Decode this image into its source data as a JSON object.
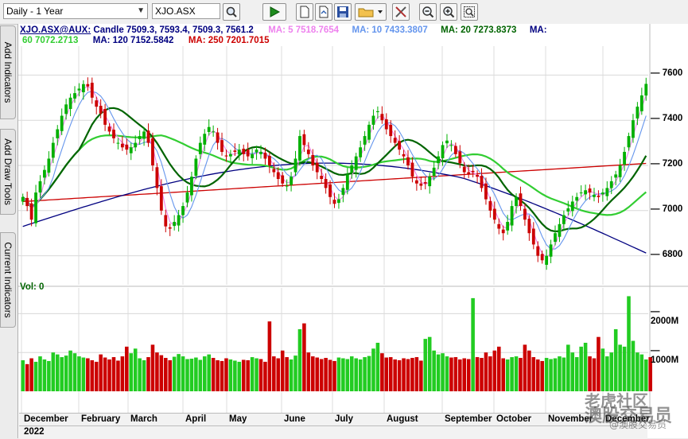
{
  "toolbar": {
    "period_select": "Daily - 1 Year",
    "symbol_input": "XJO.ASX",
    "icons": [
      "search-icon",
      "play-icon",
      "new-chart-icon",
      "open-chart-icon",
      "save-icon",
      "folder-icon",
      "dropdown-arrow-icon",
      "tools-icon",
      "zoom-out-icon",
      "zoom-in-icon",
      "zoom-fit-icon"
    ]
  },
  "side_tabs": [
    "Add Indicators",
    "Add Draw Tools",
    "Current Indicators"
  ],
  "legend": {
    "symbol": "XJO.ASX@AUX:",
    "candle": "Candle 7509.3, 7593.4, 7509.3, 7561.2",
    "ma5": "MA: 5 7518.7654",
    "ma10": "MA: 10 7433.3807",
    "ma20": "MA: 20 7273.8373",
    "ma_prefix": "MA:",
    "ma60": "60 7072.2713",
    "ma120": "MA: 120 7152.5842",
    "ma250": "MA: 250 7201.7015",
    "colors": {
      "symbol": "#000080",
      "candle": "#000080",
      "ma5": "#ee82ee",
      "ma10": "#6495ed",
      "ma20": "#006400",
      "ma60": "#32cd32",
      "ma120": "#000080",
      "ma250": "#cc0000"
    }
  },
  "volume_label": "Vol: 0",
  "months": [
    "December",
    "February",
    "March",
    "April",
    "May",
    "June",
    "July",
    "August",
    "September",
    "October",
    "November",
    "December"
  ],
  "year": "2022",
  "watermark": {
    "line1": "老虎社区",
    "line2": "澳股交易员",
    "sub": "@澳股交易员"
  },
  "chart_data": {
    "type": "candlestick",
    "price_axis": {
      "ticks": [
        7600,
        7400,
        7200,
        7000,
        6800
      ],
      "range": [
        6700,
        7700
      ]
    },
    "volume_axis": {
      "ticks": [
        "2000M",
        "1000M"
      ],
      "range": [
        0,
        2500
      ]
    },
    "last_candle": {
      "open": 7509.3,
      "high": 7593.4,
      "low": 7509.3,
      "close": 7561.2
    },
    "closes": [
      7060,
      7020,
      6960,
      7080,
      7130,
      7180,
      7230,
      7300,
      7360,
      7420,
      7470,
      7500,
      7520,
      7540,
      7560,
      7550,
      7500,
      7460,
      7430,
      7380,
      7350,
      7320,
      7300,
      7280,
      7270,
      7280,
      7300,
      7330,
      7350,
      7300,
      7200,
      7100,
      7000,
      6930,
      6920,
      6950,
      6980,
      7020,
      7080,
      7150,
      7230,
      7300,
      7340,
      7370,
      7350,
      7300,
      7260,
      7240,
      7250,
      7260,
      7270,
      7250,
      7240,
      7250,
      7270,
      7260,
      7230,
      7200,
      7170,
      7140,
      7120,
      7110,
      7150,
      7230,
      7330,
      7290,
      7250,
      7200,
      7170,
      7140,
      7100,
      7060,
      7030,
      7050,
      7100,
      7160,
      7200,
      7240,
      7280,
      7330,
      7380,
      7420,
      7440,
      7400,
      7360,
      7330,
      7300,
      7270,
      7240,
      7200,
      7150,
      7120,
      7110,
      7120,
      7150,
      7190,
      7240,
      7290,
      7310,
      7290,
      7250,
      7210,
      7170,
      7160,
      7170,
      7150,
      7100,
      7050,
      7000,
      6960,
      6920,
      6900,
      6950,
      7020,
      7060,
      7020,
      6960,
      6900,
      6850,
      6800,
      6780,
      6800,
      6850,
      6900,
      6940,
      6980,
      7010,
      7040,
      7060,
      7080,
      7090,
      7080,
      7070,
      7060,
      7080,
      7100,
      7130,
      7160,
      7200,
      7260,
      7330,
      7400,
      7460,
      7510,
      7561
    ],
    "ma_labels": [
      "MA 5",
      "MA 10",
      "MA 20",
      "MA 60",
      "MA 120",
      "MA 250"
    ],
    "volumes": [
      800,
      700,
      850,
      760,
      900,
      820,
      780,
      1000,
      950,
      880,
      920,
      1050,
      980,
      900,
      870,
      850,
      800,
      760,
      950,
      870,
      820,
      880,
      790,
      900,
      1150,
      980,
      1100,
      850,
      800,
      880,
      1200,
      1000,
      930,
      860,
      800,
      890,
      960,
      900,
      830,
      840,
      870,
      810,
      900,
      950,
      860,
      800,
      780,
      850,
      820,
      790,
      760,
      810,
      800,
      880,
      850,
      830,
      760,
      1800,
      900,
      850,
      1050,
      880,
      820,
      920,
      1600,
      1750,
      1000,
      900,
      870,
      830,
      860,
      810,
      780,
      870,
      850,
      830,
      900,
      850,
      820,
      880,
      910,
      1100,
      1250,
      980,
      870,
      880,
      820,
      800,
      850,
      830,
      860,
      880,
      790,
      1350,
      1400,
      1050,
      950,
      980,
      900,
      870,
      880,
      820,
      850,
      830,
      2400,
      880,
      860,
      1000,
      900,
      1050,
      1150,
      850,
      820,
      880,
      900,
      860,
      1200,
      1050,
      880,
      820,
      780,
      860,
      830,
      850,
      900,
      870,
      1200,
      1000,
      880,
      1150,
      1250,
      900,
      850,
      1400,
      1100,
      900,
      1000,
      1600,
      1200,
      1150,
      2450,
      1300,
      1000,
      950,
      820,
      880
    ]
  }
}
